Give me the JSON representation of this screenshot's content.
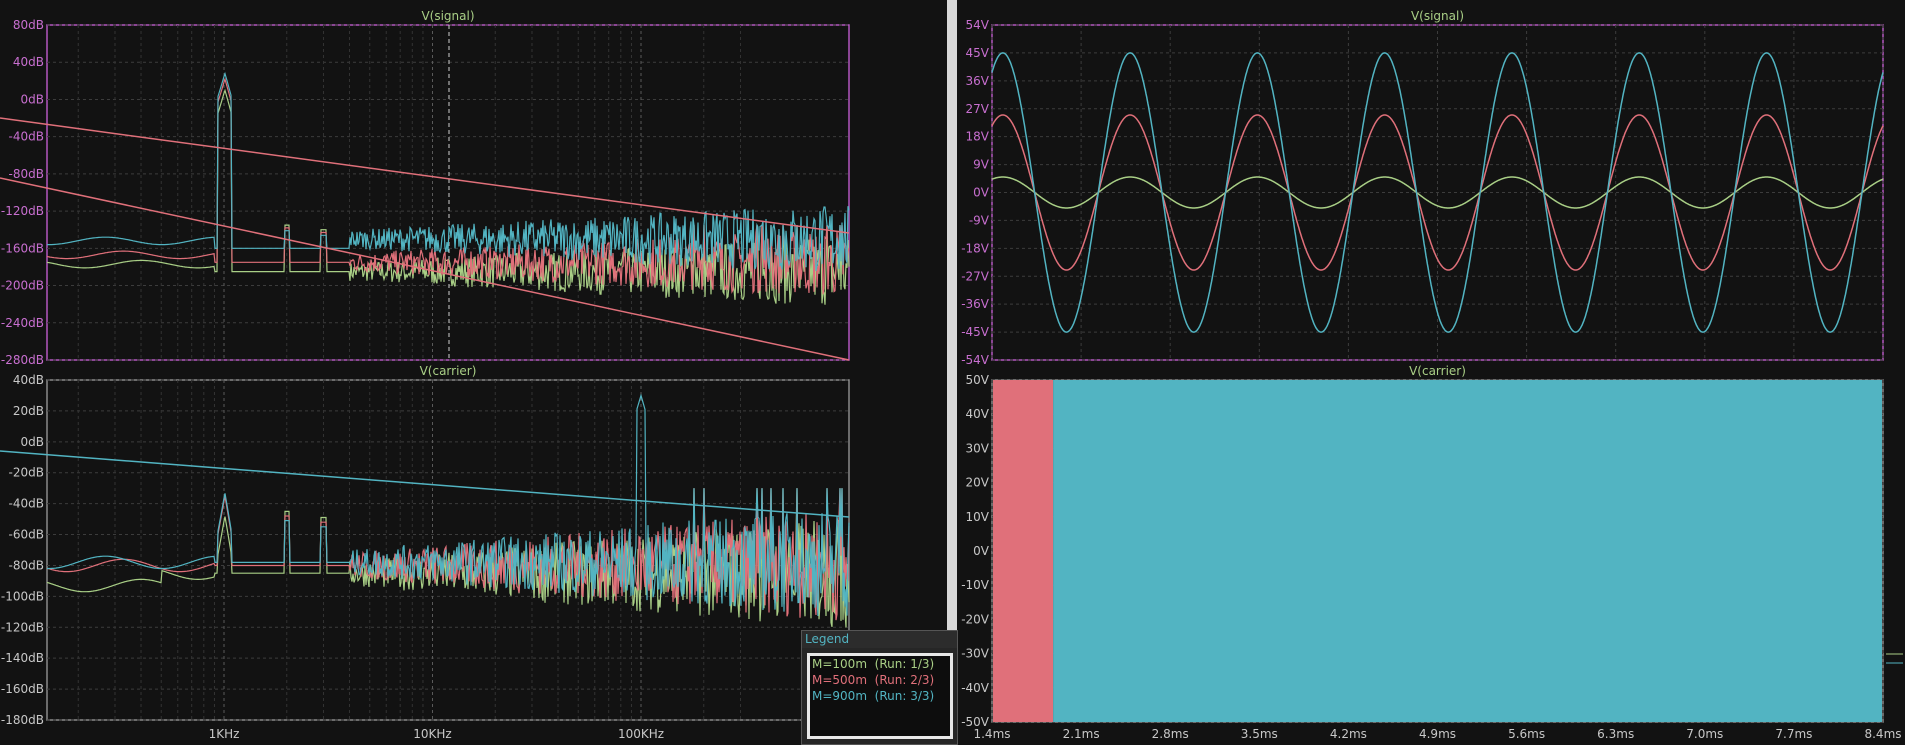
{
  "colors": {
    "run1": "#a9cf86",
    "run2": "#e0707a",
    "run3": "#52b4c2",
    "axis_db": "#c86fd0",
    "axis_v": "#c86fd0",
    "label": "#c8c8c8"
  },
  "legend": {
    "title": "Legend",
    "entries": [
      {
        "label": "M=100m",
        "run": "(Run: 1/3)",
        "color": "#a9cf86"
      },
      {
        "label": "M=500m",
        "run": "(Run: 2/3)",
        "color": "#e0707a"
      },
      {
        "label": "M=900m",
        "run": "(Run: 3/3)",
        "color": "#52b4c2"
      }
    ]
  },
  "chart_data": [
    {
      "type": "line",
      "title": "V(signal)",
      "x_scale": "log",
      "x_tick_labels": [
        "1KHz",
        "10KHz",
        "100KHz"
      ],
      "y_ticks": [
        "80dB",
        "40dB",
        "0dB",
        "-40dB",
        "-80dB",
        "-120dB",
        "-160dB",
        "-200dB",
        "-240dB",
        "-280dB"
      ],
      "ylim": [
        -280,
        80
      ],
      "grid": true,
      "series": [
        {
          "values_note_peak_db": 10,
          "floor_db": -185
        },
        {
          "values_note_peak_db": 22,
          "floor_db": -175
        },
        {
          "values_note_peak_db": 28,
          "floor_db": -160
        }
      ]
    },
    {
      "type": "line",
      "title": "V(carrier)",
      "x_scale": "log",
      "x_tick_labels": [
        "1KHz",
        "10KHz",
        "100KHz"
      ],
      "y_ticks": [
        "40dB",
        "20dB",
        "0dB",
        "-20dB",
        "-40dB",
        "-60dB",
        "-80dB",
        "-100dB",
        "-120dB",
        "-140dB",
        "-160dB",
        "-180dB"
      ],
      "ylim": [
        -180,
        40
      ],
      "grid": true
    },
    {
      "type": "line",
      "title": "V(signal)",
      "x_ticks": [
        "1.4ms",
        "2.1ms",
        "2.8ms",
        "3.5ms",
        "4.2ms",
        "4.9ms",
        "5.6ms",
        "6.3ms",
        "7.0ms",
        "7.7ms",
        "8.4ms"
      ],
      "y_ticks": [
        "54V",
        "45V",
        "36V",
        "27V",
        "18V",
        "9V",
        "0V",
        "-9V",
        "-18V",
        "-27V",
        "-36V",
        "-45V",
        "-54V"
      ],
      "ylim": [
        -54,
        54
      ],
      "xlim_ms": [
        1.4,
        8.4
      ],
      "grid": true,
      "period_ms": 1.0,
      "series": [
        {
          "amplitude_v": 5
        },
        {
          "amplitude_v": 25
        },
        {
          "amplitude_v": 45
        }
      ]
    },
    {
      "type": "area",
      "title": "V(carrier)",
      "x_ticks": [
        "1.4ms",
        "2.1ms",
        "2.8ms",
        "3.5ms",
        "4.2ms",
        "4.9ms",
        "5.6ms",
        "6.3ms",
        "7.0ms",
        "7.7ms",
        "8.4ms"
      ],
      "y_ticks": [
        "50V",
        "40V",
        "30V",
        "20V",
        "10V",
        "0V",
        "-10V",
        "-20V",
        "-30V",
        "-40V",
        "-50V"
      ],
      "ylim": [
        -50,
        50
      ],
      "xlim_ms": [
        1.4,
        8.4
      ],
      "grid": true,
      "run2_visible_until_ms": 1.88
    }
  ]
}
